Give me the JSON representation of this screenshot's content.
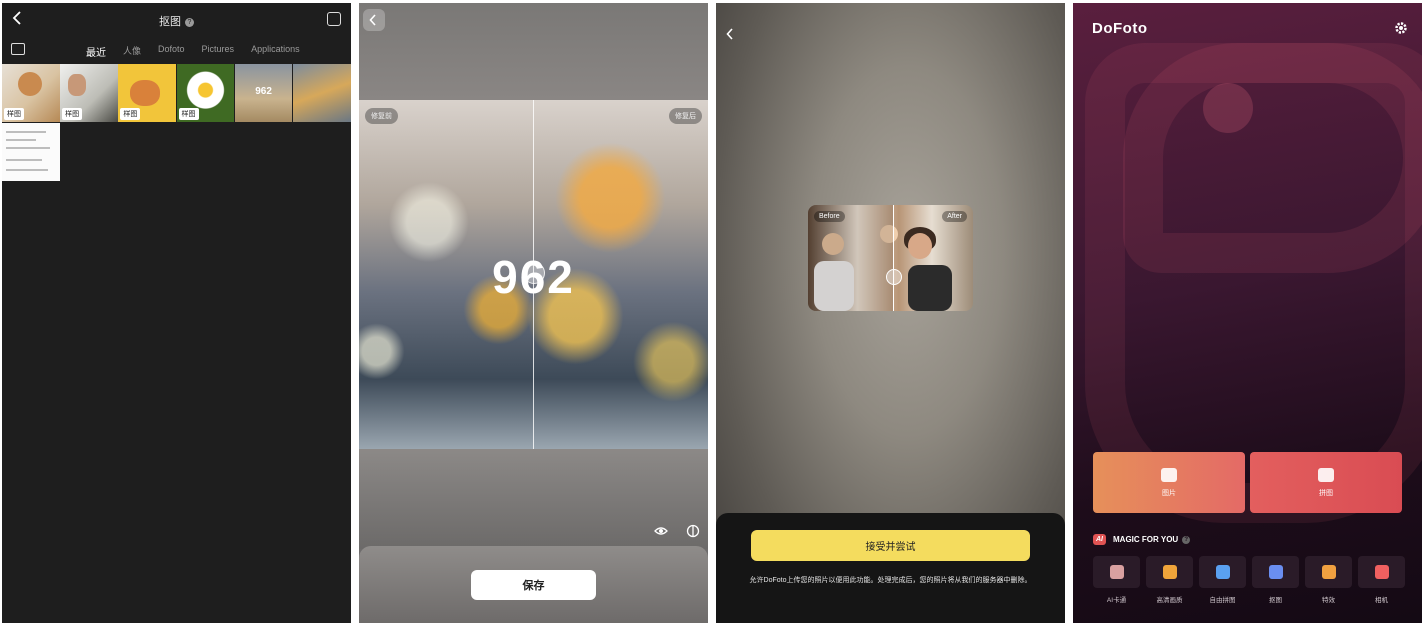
{
  "panel1": {
    "title": "抠图",
    "help_icon": "help-icon",
    "tabs": [
      {
        "label": "最近",
        "active": true
      },
      {
        "label": "人像",
        "active": false
      },
      {
        "label": "Dofoto",
        "active": false
      },
      {
        "label": "Pictures",
        "active": false
      },
      {
        "label": "Applications",
        "active": false
      }
    ],
    "thumbnails": [
      {
        "tag": "样图"
      },
      {
        "tag": "样图"
      },
      {
        "tag": "样图"
      },
      {
        "tag": "样图"
      },
      {
        "tag": "",
        "overlay_text": "962"
      },
      {
        "tag": ""
      }
    ]
  },
  "panel2": {
    "before_label": "修复前",
    "after_label": "修复后",
    "overlay_number": "962",
    "save_label": "保存"
  },
  "panel3": {
    "before_label": "Before",
    "after_label": "After",
    "accept_label": "接受并尝试",
    "consent_text": "允许DoFoto上传您的照片以便用此功能。处理完成后，您的照片将从我们的服务器中删除。"
  },
  "panel4": {
    "logo": "DoFoto",
    "photo_card_label": "图片",
    "collage_card_label": "拼图",
    "magic_badge": "AI",
    "magic_title": "MAGIC FOR YOU",
    "tools": [
      {
        "label": "AI卡通",
        "icon": "ai-cartoon-icon",
        "color": "#d9a0a0"
      },
      {
        "label": "高清画质",
        "icon": "hd-icon",
        "color": "#f0a43a"
      },
      {
        "label": "自由拼图",
        "icon": "free-collage-icon",
        "color": "#5aa0f0"
      },
      {
        "label": "抠图",
        "icon": "cutout-icon",
        "color": "#6a8ef0"
      },
      {
        "label": "特效",
        "icon": "sparkle-icon",
        "color": "#f0a040"
      },
      {
        "label": "相机",
        "icon": "camera-icon",
        "color": "#f06060"
      }
    ]
  }
}
